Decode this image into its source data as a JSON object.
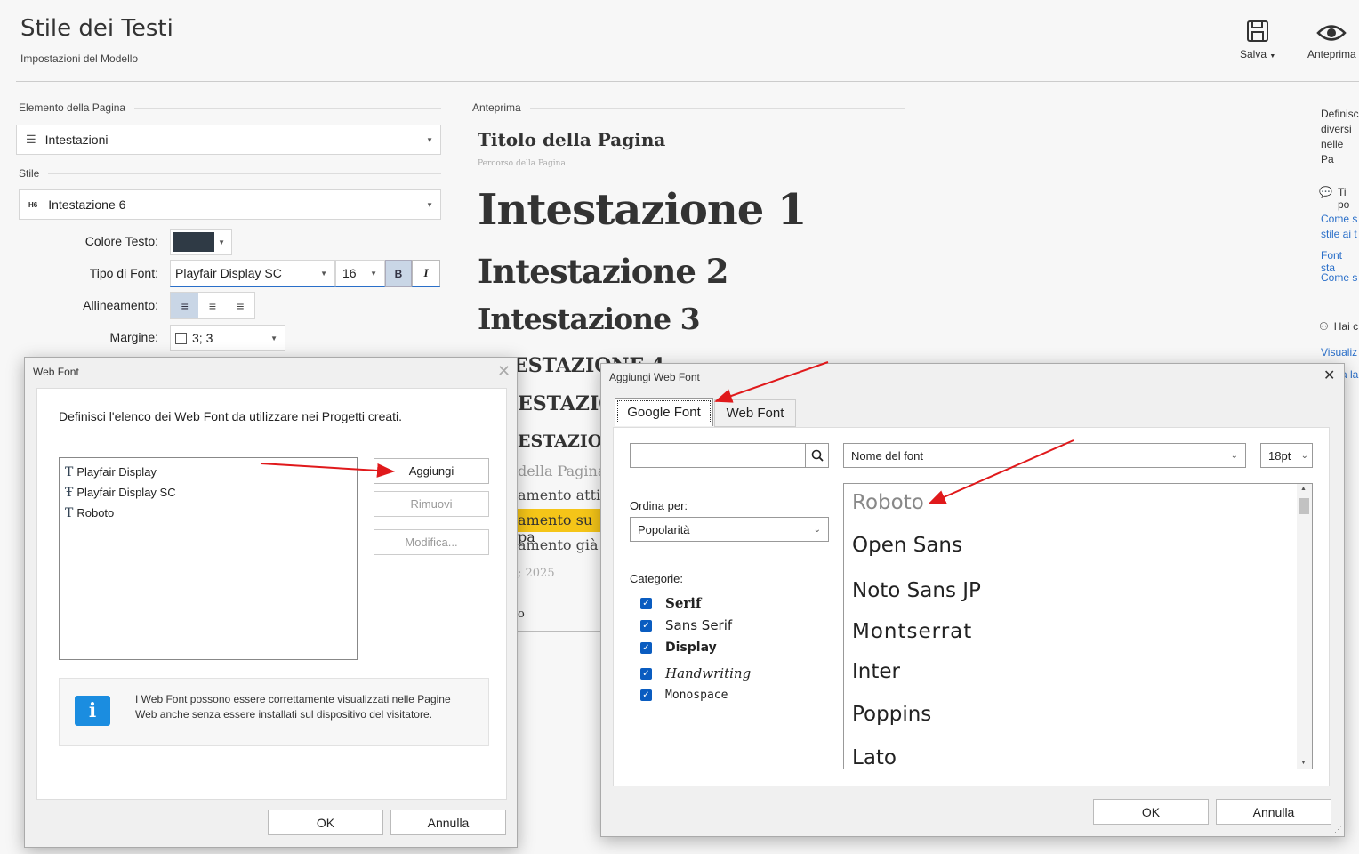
{
  "header": {
    "title": "Stile dei Testi",
    "subtitle": "Impostazioni del Modello",
    "save_label": "Salva",
    "preview_label": "Anteprima"
  },
  "left": {
    "element_section": "Elemento della Pagina",
    "element_value": "Intestazioni",
    "style_section": "Stile",
    "style_badge": "H6",
    "style_value": "Intestazione 6",
    "color_label": "Colore Testo:",
    "font_label": "Tipo di Font:",
    "font_value": "Playfair Display SC",
    "font_size": "16",
    "bold": "B",
    "italic": "I",
    "align_label": "Allineamento:",
    "margin_label": "Margine:",
    "margin_value": "3; 3",
    "text_color": "#2f3a45"
  },
  "preview": {
    "section": "Anteprima",
    "page_title": "Titolo della Pagina",
    "breadcrumb": "Percorso della Pagina",
    "h1": "Intestazione 1",
    "h2": "Intestazione 2",
    "h3": "Intestazione 3",
    "h4": "ESTAZIONE 4",
    "h5": "ESTAZIO",
    "h6": "ESTAZION",
    "text1": "della Pagina",
    "text2": "amento attivo",
    "text3": "amento su pa",
    "text4": "amento già vi",
    "text5": "; 2025",
    "text6": "o"
  },
  "right": {
    "info1": "Definisc",
    "info2": "diversi",
    "info3": "nelle Pa",
    "tips": "Ti po",
    "link1a": "Come s",
    "link1b": "stile ai t",
    "link2": "Font sta",
    "link3": "Come s",
    "have": "Hai c",
    "link4": "Visualiz",
    "link5": "a la"
  },
  "webfont_dialog": {
    "title": "Web Font",
    "description": "Definisci l'elenco dei Web Font da utilizzare nei Progetti creati.",
    "fonts": [
      "Playfair Display",
      "Playfair Display SC",
      "Roboto"
    ],
    "add": "Aggiungi",
    "remove": "Rimuovi",
    "edit": "Modifica...",
    "info": "I Web Font possono essere correttamente visualizzati nelle Pagine Web anche senza essere installati sul dispositivo del visitatore.",
    "ok": "OK",
    "cancel": "Annulla"
  },
  "add_dialog": {
    "title": "Aggiungi Web Font",
    "tab_google": "Google Font",
    "tab_web": "Web Font",
    "search_placeholder": "",
    "name_select": "Nome del font",
    "size_select": "18pt",
    "sort_label": "Ordina per:",
    "sort_value": "Popolarità",
    "categories_label": "Categorie:",
    "categories": [
      "Serif",
      "Sans Serif",
      "Display",
      "Handwriting",
      "Monospace"
    ],
    "font_list": [
      "Roboto",
      "Open Sans",
      "Noto Sans JP",
      "Montserrat",
      "Inter",
      "Poppins",
      "Lato"
    ],
    "ok": "OK",
    "cancel": "Annulla"
  },
  "colors": {
    "accent": "#0a5cc0",
    "arrow": "#e0191b",
    "highlight": "#f5c518"
  }
}
